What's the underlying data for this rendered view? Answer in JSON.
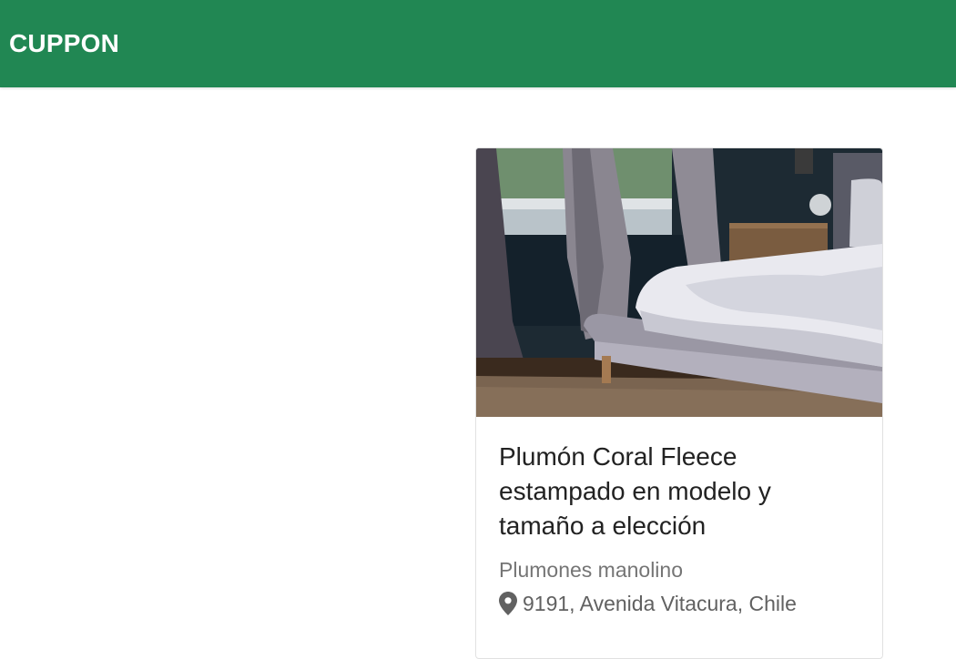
{
  "appbar": {
    "brand": "CUPPON",
    "color": "#218753"
  },
  "deal_card": {
    "image_description_icon": "bedroom-photo",
    "title": "Plumón Coral Fleece estampado en modelo y tamaño a elección",
    "merchant": "Plumones manolino",
    "location_icon": "map-pin-icon",
    "location": "9191, Avenida Vitacura, Chile"
  }
}
